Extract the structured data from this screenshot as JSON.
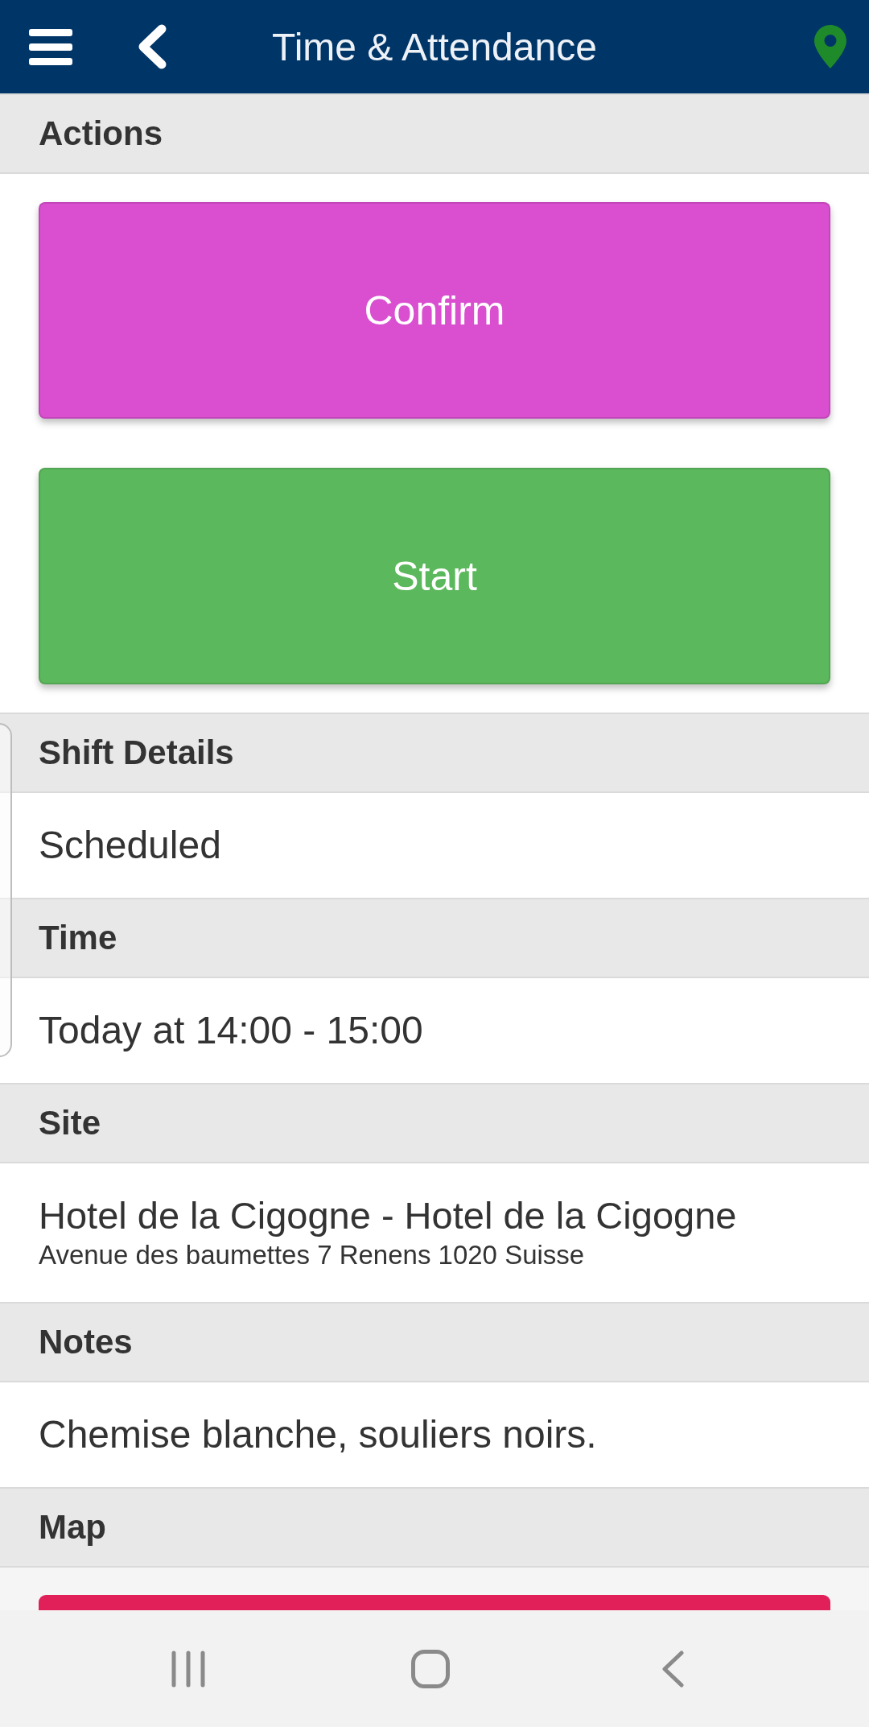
{
  "top_bar": {
    "title": "Time & Attendance"
  },
  "sections": [
    {
      "kind": "buttons",
      "header": "Actions",
      "buttons": [
        {
          "label": "Confirm",
          "color": "#d94fd0"
        },
        {
          "label": "Start",
          "color": "#5cb85c"
        }
      ]
    },
    {
      "kind": "text",
      "header": "Shift Details",
      "value": "Scheduled"
    },
    {
      "kind": "text",
      "header": "Time",
      "value": "Today at 14:00 - 15:00"
    },
    {
      "kind": "site",
      "header": "Site",
      "name": "Hotel de la Cigogne - Hotel de la Cigogne",
      "address": "Avenue des baumettes 7 Renens 1020 Suisse"
    },
    {
      "kind": "text",
      "header": "Notes",
      "value": "Chemise blanche, souliers noirs."
    },
    {
      "kind": "map",
      "header": "Map"
    }
  ]
}
